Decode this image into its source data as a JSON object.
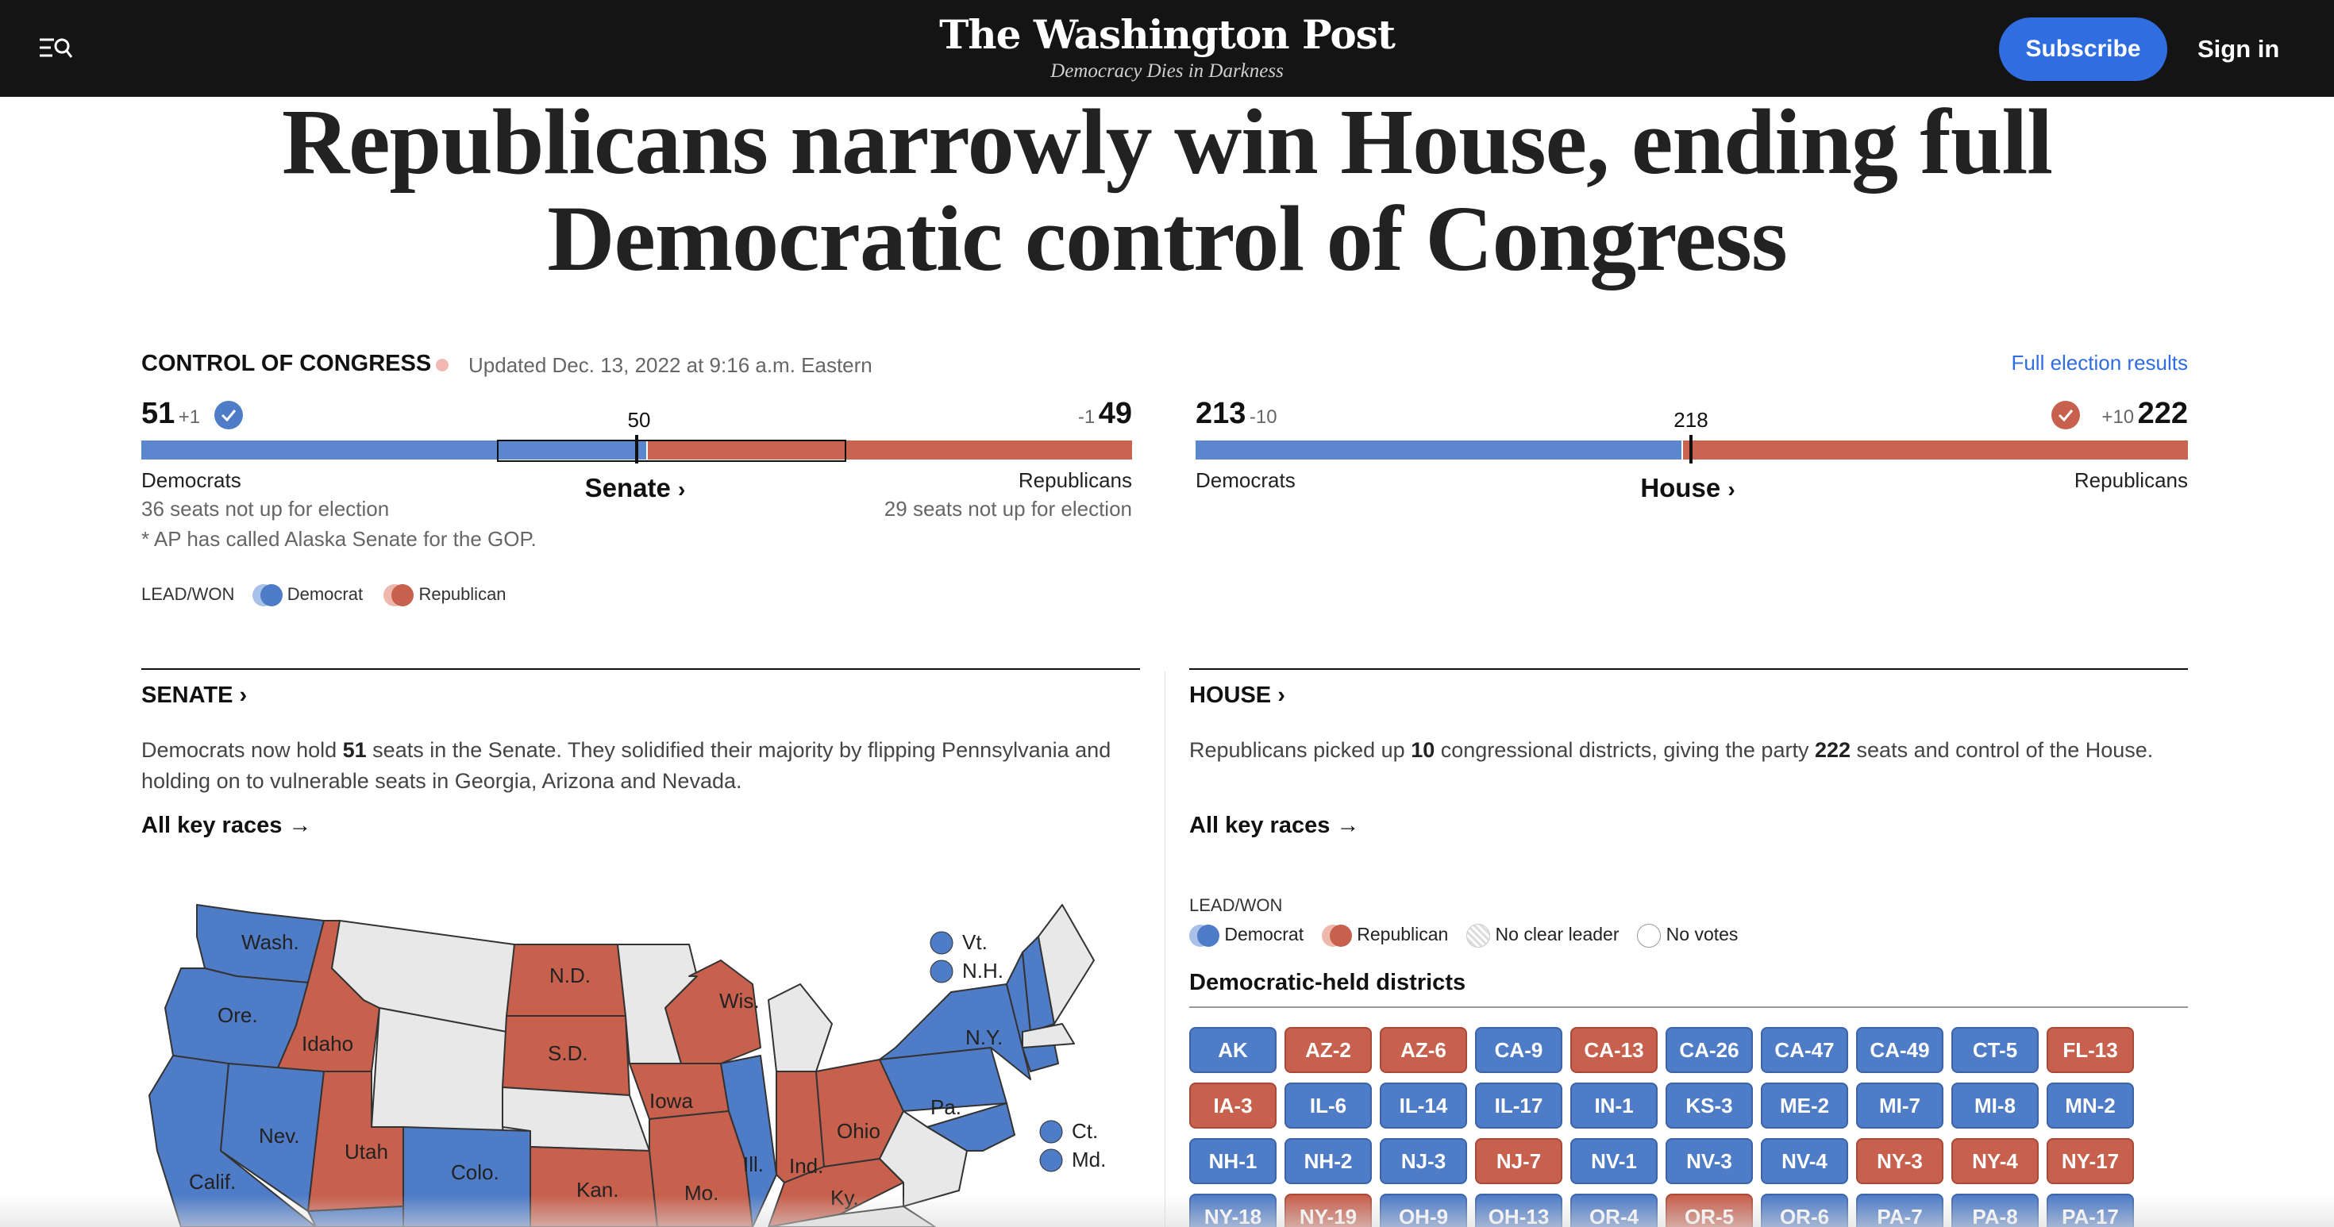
{
  "header": {
    "logo": "The Washington Post",
    "tagline": "Democracy Dies in Darkness",
    "subscribe": "Subscribe",
    "signin": "Sign in"
  },
  "headline": "Republicans narrowly win House, ending full Democratic control of Congress",
  "control": {
    "title": "CONTROL OF CONGRESS",
    "updated": "Updated Dec. 13, 2022 at 9:16 a.m. Eastern",
    "full_results": "Full election results",
    "senate": {
      "dem_seats": "51",
      "dem_change": "+1",
      "rep_seats": "49",
      "rep_change": "-1",
      "majority": "50",
      "dem_label": "Democrats",
      "rep_label": "Republicans",
      "title": "Senate",
      "dem_note": "36 seats not up for election",
      "rep_note": "29 seats not up for election",
      "footnote": "* AP has called Alaska Senate for the GOP.",
      "dem_fraction": 0.51
    },
    "house": {
      "dem_seats": "213",
      "dem_change": "-10",
      "rep_seats": "222",
      "rep_change": "+10",
      "majority": "218",
      "dem_label": "Democrats",
      "rep_label": "Republicans",
      "title": "House",
      "dem_fraction": 0.4897
    },
    "legend": {
      "label": "LEAD/WON",
      "dem": "Democrat",
      "rep": "Republican"
    }
  },
  "senate_section": {
    "title": "SENATE",
    "text_pre": "Democrats now hold ",
    "text_bold": "51",
    "text_post": " seats in the Senate. They solidified their majority by flipping Pennsylvania and holding on to vulnerable seats in Georgia, Arizona and Nevada.",
    "key_races": "All key races"
  },
  "house_section": {
    "title": "HOUSE",
    "text_1": "Republicans picked up ",
    "text_bold_1": "10",
    "text_2": " congressional districts, giving the party ",
    "text_bold_2": "222",
    "text_3": " seats and control of the House.",
    "key_races": "All key races",
    "legend_label": "LEAD/WON",
    "legend": [
      "Democrat",
      "Republican",
      "No clear leader",
      "No votes"
    ],
    "districts_title": "Democratic-held districts",
    "districts": [
      [
        "AK",
        "d"
      ],
      [
        "AZ-2",
        "r"
      ],
      [
        "AZ-6",
        "r"
      ],
      [
        "CA-9",
        "d"
      ],
      [
        "CA-13",
        "r"
      ],
      [
        "CA-26",
        "d"
      ],
      [
        "CA-47",
        "d"
      ],
      [
        "CA-49",
        "d"
      ],
      [
        "CT-5",
        "d"
      ],
      [
        "FL-13",
        "r"
      ],
      [
        "IA-3",
        "r"
      ],
      [
        "IL-6",
        "d"
      ],
      [
        "IL-14",
        "d"
      ],
      [
        "IL-17",
        "d"
      ],
      [
        "IN-1",
        "d"
      ],
      [
        "KS-3",
        "d"
      ],
      [
        "ME-2",
        "d"
      ],
      [
        "MI-7",
        "d"
      ],
      [
        "MI-8",
        "d"
      ],
      [
        "MN-2",
        "d"
      ],
      [
        "NH-1",
        "d"
      ],
      [
        "NH-2",
        "d"
      ],
      [
        "NJ-3",
        "d"
      ],
      [
        "NJ-7",
        "r"
      ],
      [
        "NV-1",
        "d"
      ],
      [
        "NV-3",
        "d"
      ],
      [
        "NV-4",
        "d"
      ],
      [
        "NY-3",
        "r"
      ],
      [
        "NY-4",
        "r"
      ],
      [
        "NY-17",
        "r"
      ],
      [
        "NY-18",
        "d"
      ],
      [
        "NY-19",
        "r"
      ],
      [
        "OH-9",
        "d"
      ],
      [
        "OH-13",
        "d"
      ],
      [
        "OR-4",
        "d"
      ],
      [
        "OR-5",
        "r"
      ],
      [
        "OR-6",
        "d"
      ],
      [
        "PA-7",
        "d"
      ],
      [
        "PA-8",
        "d"
      ],
      [
        "PA-17",
        "d"
      ]
    ]
  },
  "map": {
    "labels": [
      "Wash.",
      "Ore.",
      "Idaho",
      "Calif.",
      "Nev.",
      "Utah",
      "Colo.",
      "N.D.",
      "S.D.",
      "Kan.",
      "Iowa",
      "Mo.",
      "Wis.",
      "Ill.",
      "Ind.",
      "Ohio",
      "Ky.",
      "Pa.",
      "N.Y.",
      "Vt.",
      "N.H.",
      "Ct.",
      "Md."
    ],
    "colors": {
      "dem": "#4f7cc7",
      "rep": "#c7604d",
      "none": "#e8e8e8"
    }
  }
}
